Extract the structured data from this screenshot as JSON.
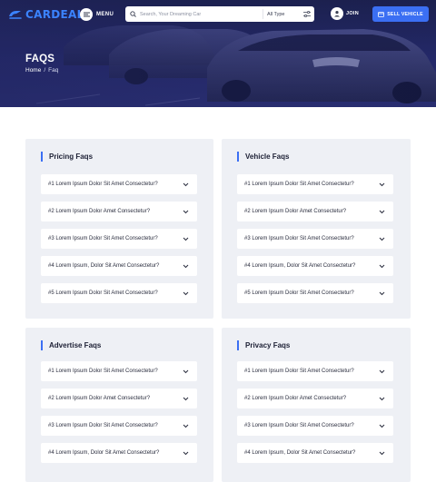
{
  "header": {
    "logo_text": "CARDEAL",
    "menu_label": "MENU",
    "search": {
      "placeholder": "Search, Your Dreaming Car",
      "type_value": "All Type"
    },
    "join_label": "JOIN",
    "sell_label": "SELL VEHICLE"
  },
  "hero": {
    "title": "FAQS",
    "breadcrumb": {
      "home": "Home",
      "separator": "/",
      "current": "Faq"
    }
  },
  "sections": [
    {
      "title": "Pricing Faqs",
      "items": [
        "#1 Lorem Ipsum Dolor Sit Amet Consectetur?",
        "#2 Lorem Ipsum Dolor Amet Consectetur?",
        "#3 Lorem Ipsum Dolor Sit Amet Consectetur?",
        "#4 Lorem Ipsum, Dolor Sit Amet Consectetur?",
        "#5 Lorem Ipsum Dolor Sit Amet Consectetur?"
      ]
    },
    {
      "title": "Vehicle Faqs",
      "items": [
        "#1 Lorem Ipsum Dolor Sit Amet Consectetur?",
        "#2 Lorem Ipsum Dolor Amet Consectetur?",
        "#3 Lorem Ipsum Dolor Sit Amet Consectetur?",
        "#4 Lorem Ipsum, Dolor Sit Amet Consectetur?",
        "#5 Lorem Ipsum Dolor Sit Amet Consectetur?"
      ]
    },
    {
      "title": "Advertise Faqs",
      "items": [
        "#1 Lorem Ipsum Dolor Sit Amet Consectetur?",
        "#2 Lorem Ipsum Dolor Amet Consectetur?",
        "#3 Lorem Ipsum Dolor Sit Amet Consectetur?",
        "#4 Lorem Ipsum, Dolor Sit Amet Consectetur?"
      ]
    },
    {
      "title": "Privacy Faqs",
      "items": [
        "#1 Lorem Ipsum Dolor Sit Amet Consectetur?",
        "#2 Lorem Ipsum Dolor Amet Consectetur?",
        "#3 Lorem Ipsum Dolor Sit Amet Consectetur?",
        "#4 Lorem Ipsum, Dolor Sit Amet Consectetur?"
      ]
    }
  ],
  "colors": {
    "accent": "#3b6ff3",
    "logo": "#3b83ff",
    "hero": "#24296a",
    "card_bg": "#eef0f5"
  },
  "icons": [
    "logo-mark-icon",
    "menu-icon",
    "search-icon",
    "filter-icon",
    "user-icon",
    "sell-icon",
    "chevron-down-icon"
  ]
}
